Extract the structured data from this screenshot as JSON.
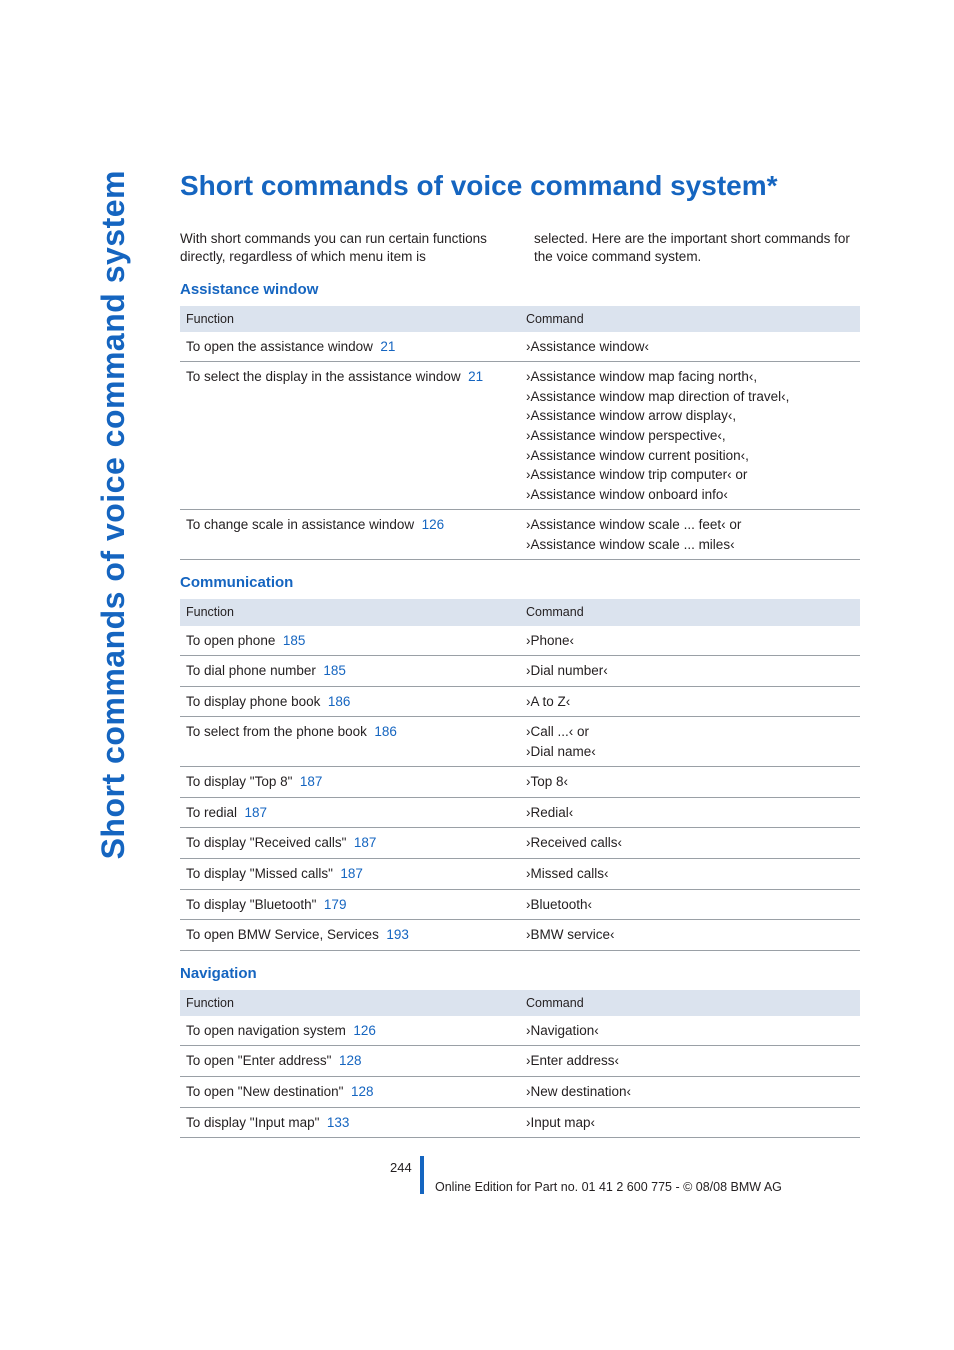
{
  "sidebar": {
    "text": "Short commands of voice command system"
  },
  "title": "Short commands of voice command system*",
  "intro": {
    "left": "With short commands you can run certain functions directly, regardless of which menu item is",
    "right": "selected. Here are the important short commands for the voice command system."
  },
  "sections": [
    {
      "heading": "Assistance window",
      "head_func": "Function",
      "head_cmd": "Command",
      "rows": [
        {
          "func": "To open the assistance window",
          "page": "21",
          "cmd": "›Assistance window‹"
        },
        {
          "func": "To select the display in the assistance window",
          "page": "21",
          "cmd": "›Assistance window map facing north‹,\n›Assistance window map direction of travel‹,\n›Assistance window arrow display‹,\n›Assistance window perspective‹,\n›Assistance window current position‹,\n›Assistance window trip computer‹ or\n›Assistance window onboard info‹"
        },
        {
          "func": "To change scale in assistance window",
          "page": "126",
          "cmd": "›Assistance window scale ... feet‹ or\n›Assistance window scale ... miles‹"
        }
      ]
    },
    {
      "heading": "Communication",
      "head_func": "Function",
      "head_cmd": "Command",
      "rows": [
        {
          "func": "To open phone",
          "page": "185",
          "cmd": "›Phone‹"
        },
        {
          "func": "To dial phone number",
          "page": "185",
          "cmd": "›Dial number‹"
        },
        {
          "func": "To display phone book",
          "page": "186",
          "cmd": "›A to Z‹"
        },
        {
          "func": "To select from the phone book",
          "page": "186",
          "cmd": "›Call ...‹ or\n›Dial name‹"
        },
        {
          "func": "To display \"Top 8\"",
          "page": "187",
          "cmd": "›Top 8‹"
        },
        {
          "func": "To redial",
          "page": "187",
          "cmd": "›Redial‹"
        },
        {
          "func": "To display \"Received calls\"",
          "page": "187",
          "cmd": "›Received calls‹"
        },
        {
          "func": "To display \"Missed calls\"",
          "page": "187",
          "cmd": "›Missed calls‹"
        },
        {
          "func": "To display \"Bluetooth\"",
          "page": "179",
          "cmd": "›Bluetooth‹"
        },
        {
          "func": "To open BMW Service, Services",
          "page": "193",
          "cmd": "›BMW service‹"
        }
      ]
    },
    {
      "heading": "Navigation",
      "head_func": "Function",
      "head_cmd": "Command",
      "rows": [
        {
          "func": "To open navigation system",
          "page": "126",
          "cmd": "›Navigation‹"
        },
        {
          "func": "To open \"Enter address\"",
          "page": "128",
          "cmd": "›Enter address‹"
        },
        {
          "func": "To open \"New destination\"",
          "page": "128",
          "cmd": "›New destination‹"
        },
        {
          "func": "To display \"Input map\"",
          "page": "133",
          "cmd": "›Input map‹"
        }
      ]
    }
  ],
  "footer": {
    "page_number": "244",
    "edition": "Online Edition for Part no. 01 41 2 600 775 - © 08/08 BMW AG"
  }
}
